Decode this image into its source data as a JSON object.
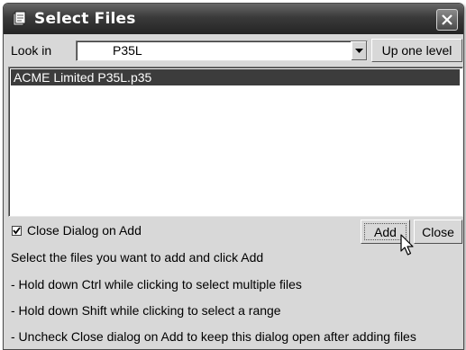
{
  "window": {
    "title": "Select Files",
    "title_icon": "dialog-app-icon",
    "close_icon": "close-x-icon"
  },
  "look_in": {
    "label": "Look in",
    "value": "P35L",
    "dropdown_icon": "chevron-down-icon",
    "up_button": "Up one level"
  },
  "files": {
    "items": [
      {
        "name": "ACME Limited P35L.p35",
        "selected": true
      }
    ]
  },
  "options": {
    "close_on_add_label": "Close Dialog on Add",
    "close_on_add_checked": true
  },
  "buttons": {
    "add": "Add",
    "close": "Close"
  },
  "instructions": {
    "intro": "Select the files you want to add and click Add",
    "tips": [
      " - Hold down Ctrl while clicking to select multiple files",
      " - Hold down Shift while clicking to select a range",
      " - Uncheck Close dialog on Add to keep this dialog open after adding files"
    ]
  },
  "colors": {
    "selection": "#3c3c3c",
    "titlebar": "#2e2e2e",
    "dialog_bg": "#d8d8d8"
  }
}
